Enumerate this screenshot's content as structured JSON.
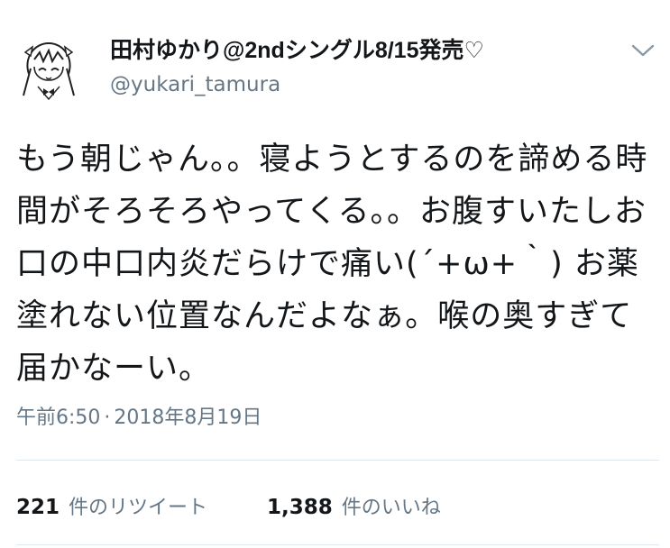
{
  "author": {
    "display_name": "田村ゆかり@2ndシングル8/15発売♡",
    "handle": "@yukari_tamura",
    "avatar_icon": "anime-girl-avatar-icon"
  },
  "tweet": {
    "text": "もう朝じゃん。。寝ようとするのを諦める時間がそろそろやってくる。。お腹すいたしお口の中口内炎だらけで痛い(´+ω+｀) お薬塗れない位置なんだよなぁ。喉の奥すぎて届かなーい。",
    "time": "午前6:50",
    "separator": "·",
    "date": "2018年8月19日"
  },
  "stats": {
    "retweets_count": "221",
    "retweets_label": "件のリツイート",
    "likes_count": "1,388",
    "likes_label": "件のいいね"
  },
  "icons": {
    "more": "chevron-down-icon"
  },
  "colors": {
    "text": "#14171a",
    "secondary": "#657786",
    "divider": "#e1e8ed"
  }
}
